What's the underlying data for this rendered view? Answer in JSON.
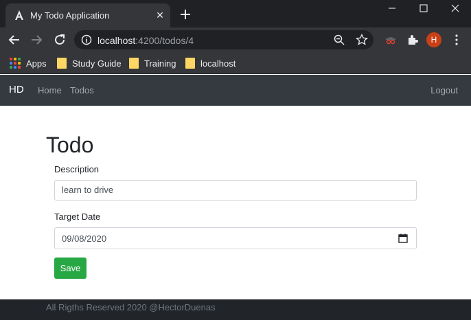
{
  "browser": {
    "tab_title": "My Todo Application",
    "url_host": "localhost",
    "url_path": ":4200/todos/4",
    "profile_initial": "H",
    "bookmarks": [
      "Apps",
      "Study Guide",
      "Training",
      "localhost"
    ]
  },
  "app": {
    "brand": "HD",
    "nav": {
      "home": "Home",
      "todos": "Todos",
      "logout": "Logout"
    },
    "page_title": "Todo",
    "form": {
      "description_label": "Description",
      "description_value": "learn to drive",
      "target_date_label": "Target Date",
      "target_date_value": "09/08/2020",
      "save_label": "Save"
    },
    "footer": "All Rigths Reserved 2020 @HectorDuenas"
  },
  "colors": {
    "navbar": "#343a40",
    "save_button": "#28a745",
    "footer": "#212529",
    "profile": "#c94016"
  }
}
